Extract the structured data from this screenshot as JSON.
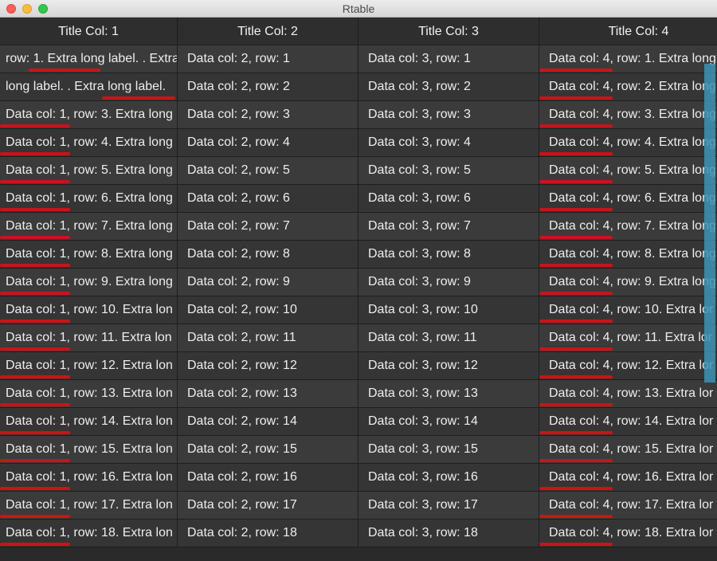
{
  "window": {
    "title": "Rtable",
    "controls": [
      "close",
      "minimize",
      "maximize"
    ]
  },
  "table": {
    "headers": [
      "Title Col: 1",
      "Title Col: 2",
      "Title Col: 3",
      "Title Col: 4"
    ],
    "rows": [
      [
        "row: 1. Extra long label. . Extra",
        "Data col: 2, row: 1",
        "Data col: 3, row: 1",
        "Data col: 4, row: 1. Extra long"
      ],
      [
        "long label. . Extra long label.",
        "Data col: 2, row: 2",
        "Data col: 3, row: 2",
        "Data col: 4, row: 2. Extra long"
      ],
      [
        "Data col: 1, row: 3. Extra long",
        "Data col: 2, row: 3",
        "Data col: 3, row: 3",
        "Data col: 4, row: 3. Extra long"
      ],
      [
        "Data col: 1, row: 4. Extra long",
        "Data col: 2, row: 4",
        "Data col: 3, row: 4",
        "Data col: 4, row: 4. Extra long"
      ],
      [
        "Data col: 1, row: 5. Extra long",
        "Data col: 2, row: 5",
        "Data col: 3, row: 5",
        "Data col: 4, row: 5. Extra long"
      ],
      [
        "Data col: 1, row: 6. Extra long",
        "Data col: 2, row: 6",
        "Data col: 3, row: 6",
        "Data col: 4, row: 6. Extra long"
      ],
      [
        "Data col: 1, row: 7. Extra long",
        "Data col: 2, row: 7",
        "Data col: 3, row: 7",
        "Data col: 4, row: 7. Extra long"
      ],
      [
        "Data col: 1, row: 8. Extra long",
        "Data col: 2, row: 8",
        "Data col: 3, row: 8",
        "Data col: 4, row: 8. Extra long"
      ],
      [
        "Data col: 1, row: 9. Extra long",
        "Data col: 2, row: 9",
        "Data col: 3, row: 9",
        "Data col: 4, row: 9. Extra long"
      ],
      [
        "Data col: 1, row: 10. Extra lon",
        "Data col: 2, row: 10",
        "Data col: 3, row: 10",
        "Data col: 4, row: 10. Extra lor"
      ],
      [
        "Data col: 1, row: 11. Extra lon",
        "Data col: 2, row: 11",
        "Data col: 3, row: 11",
        "Data col: 4, row: 11. Extra lor"
      ],
      [
        "Data col: 1, row: 12. Extra lon",
        "Data col: 2, row: 12",
        "Data col: 3, row: 12",
        "Data col: 4, row: 12. Extra lor"
      ],
      [
        "Data col: 1, row: 13. Extra lon",
        "Data col: 2, row: 13",
        "Data col: 3, row: 13",
        "Data col: 4, row: 13. Extra lor"
      ],
      [
        "Data col: 1, row: 14. Extra lon",
        "Data col: 2, row: 14",
        "Data col: 3, row: 14",
        "Data col: 4, row: 14. Extra lor"
      ],
      [
        "Data col: 1, row: 15. Extra lon",
        "Data col: 2, row: 15",
        "Data col: 3, row: 15",
        "Data col: 4, row: 15. Extra lor"
      ],
      [
        "Data col: 1, row: 16. Extra lon",
        "Data col: 2, row: 16",
        "Data col: 3, row: 16",
        "Data col: 4, row: 16. Extra lor"
      ],
      [
        "Data col: 1, row: 17. Extra lon",
        "Data col: 2, row: 17",
        "Data col: 3, row: 17",
        "Data col: 4, row: 17. Extra lor"
      ],
      [
        "Data col: 1, row: 18. Extra lon",
        "Data col: 2, row: 18",
        "Data col: 3, row: 18",
        "Data col: 4, row: 18. Extra lor"
      ]
    ]
  },
  "colors": {
    "underline": "#c8141a",
    "scrollbar": "#3d94b5",
    "background": "#2f2f2f"
  }
}
